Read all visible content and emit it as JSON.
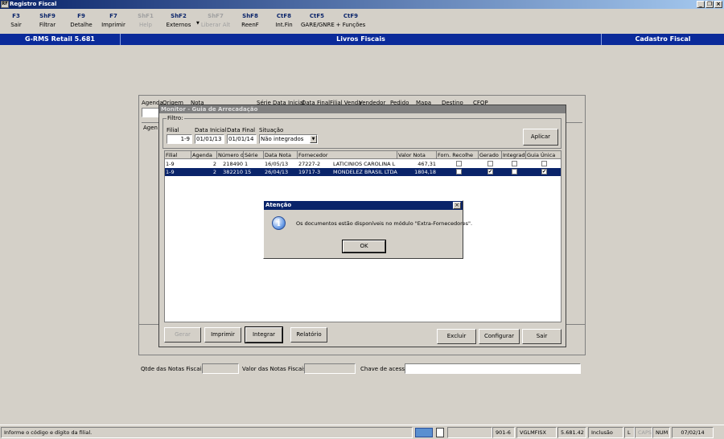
{
  "window": {
    "title": "Registro Fiscal",
    "app_icon": "app-icon"
  },
  "toolbar": [
    {
      "key": "F3",
      "label": "Sair",
      "enabled": true
    },
    {
      "key": "ShF9",
      "label": "Filtrar",
      "enabled": true
    },
    {
      "key": "F9",
      "label": "Detalhe",
      "enabled": true
    },
    {
      "key": "F7",
      "label": "Imprimir",
      "enabled": true
    },
    {
      "key": "ShF1",
      "label": "Help",
      "enabled": false
    },
    {
      "key": "ShF2",
      "label": "Externos",
      "enabled": true
    },
    {
      "key": "ShF7",
      "label": "Liberar Alt",
      "enabled": false
    },
    {
      "key": "ShF8",
      "label": "ReenF",
      "enabled": true
    },
    {
      "key": "CtF8",
      "label": "Int.Fin",
      "enabled": true
    },
    {
      "key": "CtF5",
      "label": "GARE/GNRE",
      "enabled": true
    },
    {
      "key": "CtF9",
      "label": "+ Funções",
      "enabled": true
    }
  ],
  "header": {
    "left": "G-RMS Retail 5.681",
    "center": "Livros Fiscais",
    "right": "Cadastro Fiscal"
  },
  "background_form": {
    "columns": [
      "Agenda",
      "Origem",
      "Nota",
      "Série",
      "Data Inicial",
      "Data Final",
      "Filial Venda",
      "Vendedor",
      "Pedido",
      "Mapa",
      "Destino",
      "CFOP"
    ],
    "side_label": "Agen",
    "totals": {
      "qtde_label": "Qtde das Notas Fiscais:",
      "valor_label": "Valor das Notas Fiscais:",
      "chave_label": "Chave de acesso:"
    }
  },
  "dialog": {
    "title": "Monitor - Guia de Arrecadação",
    "filter": {
      "group_label": "Filtro:",
      "filial_label": "Filial",
      "filial_value": "1-9",
      "data_inicial_label": "Data Inicial",
      "data_inicial_value": "01/01/13",
      "data_final_label": "Data Final",
      "data_final_value": "01/01/14",
      "situacao_label": "Situação",
      "situacao_value": "Não integrados"
    },
    "aplicar": "Aplicar",
    "grid": {
      "headers": [
        "Filial",
        "Agenda",
        "Número da",
        "Série",
        "Data Nota",
        "Fornecedor",
        "Valor Nota",
        "Forn. Recolhe",
        "Gerado",
        "Integrado",
        "Guia Única"
      ],
      "rows": [
        {
          "filial": "1-9",
          "agenda": "2",
          "numero": "218490",
          "serie": "1",
          "data": "16/05/13",
          "forn_cod": "27227-2",
          "forn_nome": "LATICINIOS CAROLINA L",
          "valor": "467,31",
          "recolhe": false,
          "gerado": false,
          "integrado": false,
          "guia": false,
          "selected": false
        },
        {
          "filial": "1-9",
          "agenda": "2",
          "numero": "382210",
          "serie": "15",
          "data": "26/04/13",
          "forn_cod": "19717-3",
          "forn_nome": "MONDELEZ BRASIL LTDA",
          "valor": "1804,18",
          "recolhe": false,
          "gerado": true,
          "integrado": false,
          "guia": true,
          "selected": true
        }
      ]
    },
    "buttons": {
      "gerar": "Gerar",
      "imprimir": "Imprimir",
      "integrar": "Integrar",
      "relatorio": "Relatório",
      "excluir": "Excluir",
      "configurar": "Configurar",
      "sair": "Sair"
    }
  },
  "alert": {
    "title": "Atenção",
    "message": "Os documentos estão disponíveis no módulo \"Extra-Fornecedores\".",
    "ok": "OK",
    "icon": "info-icon"
  },
  "status": {
    "message": "Informe o código e dígito da filial.",
    "code": "901-6",
    "user": "VGLMFISX",
    "version": "5.681.42",
    "mode": "Inclusão",
    "l": "L",
    "caps": "CAPS",
    "num": "NUM",
    "date": "07/02/14"
  },
  "colors": {
    "title_start": "#0a246a",
    "header_blue": "#0a2a9a",
    "selection": "#0a246a"
  }
}
